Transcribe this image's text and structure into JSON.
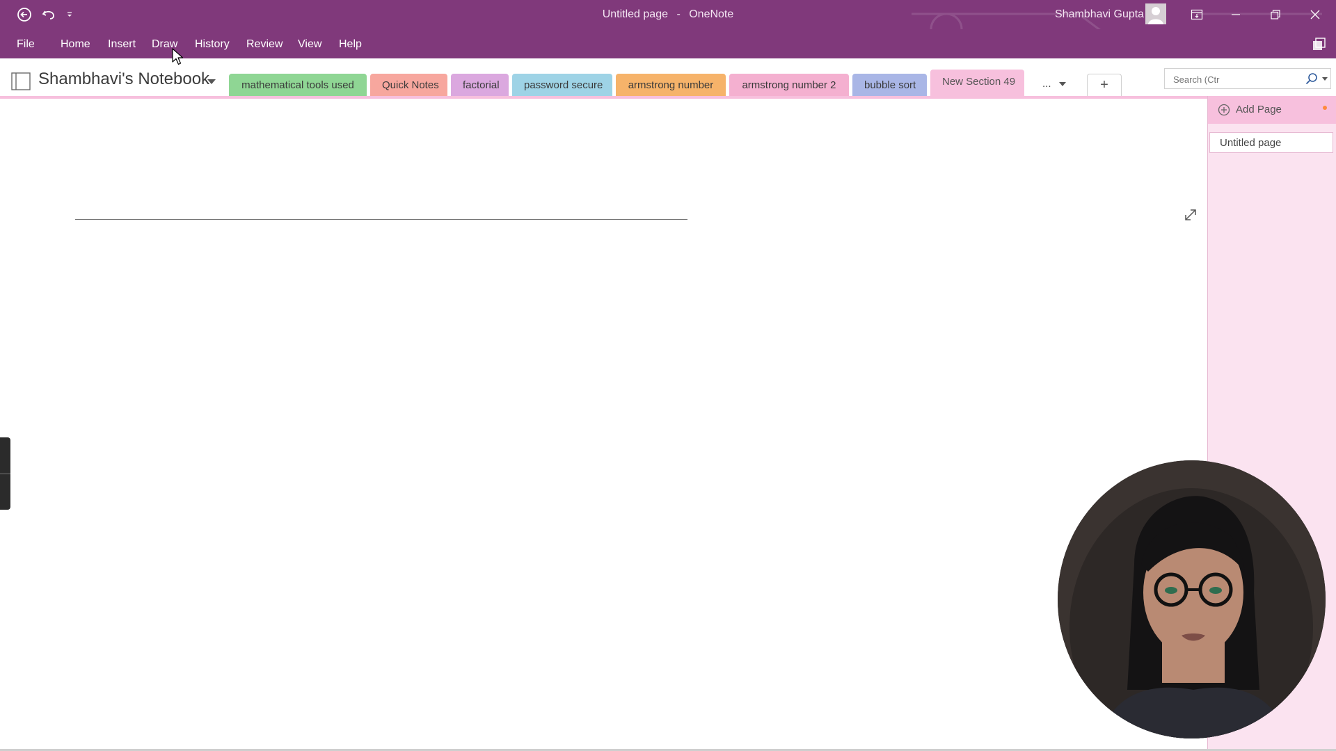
{
  "window": {
    "page_name": "Untitled page",
    "separator": "-",
    "app_name": "OneNote",
    "user_name": "Shambhavi Gupta"
  },
  "quick_access": {
    "back_icon": "back-arrow-icon",
    "undo_icon": "undo-icon",
    "customize_icon": "customize-caret-icon"
  },
  "menu": {
    "items": [
      "File",
      "Home",
      "Insert",
      "Draw",
      "History",
      "Review",
      "View",
      "Help"
    ]
  },
  "notebook": {
    "name": "Shambhavi's Notebook"
  },
  "sections": [
    {
      "label": "mathematical tools used",
      "color": "#8fd694"
    },
    {
      "label": "Quick Notes",
      "color": "#f7a79e"
    },
    {
      "label": "factorial",
      "color": "#dba8df"
    },
    {
      "label": "password secure",
      "color": "#9ed3e6"
    },
    {
      "label": "armstrong number",
      "color": "#f6b36a"
    },
    {
      "label": "armstrong number 2",
      "color": "#f4b0d0"
    },
    {
      "label": "bubble sort",
      "color": "#a9b6e6"
    },
    {
      "label": "New Section 49",
      "color": "#f7c0dd",
      "active": true
    }
  ],
  "section_more": "...",
  "section_add": "+",
  "search": {
    "placeholder": "Search (Ctr"
  },
  "page_list": {
    "add_page_label": "Add Page",
    "pages": [
      "Untitled page"
    ]
  },
  "colors": {
    "titlebar": "#80397b",
    "active_section": "#f7c0dd",
    "page_pane": "#fbe3f0"
  }
}
